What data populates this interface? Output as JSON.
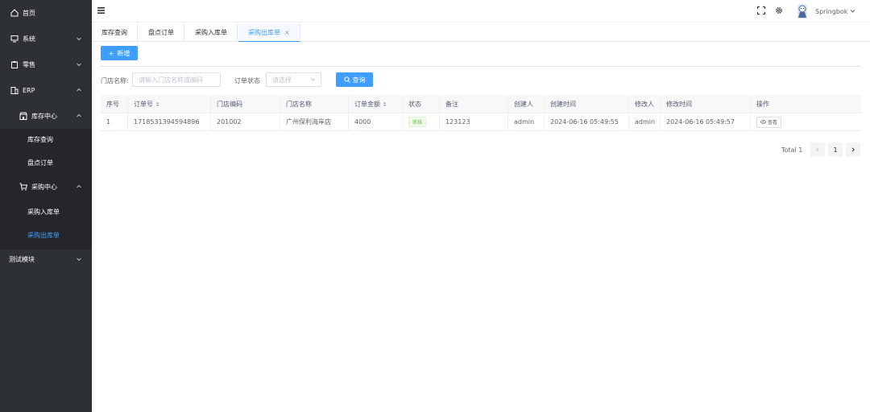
{
  "sidebar": {
    "home": "首页",
    "system": "系统",
    "retail": "零售",
    "erp": "ERP",
    "inventory_center": "库存中心",
    "inventory_query": "库存查询",
    "stocktake_order": "盘点订单",
    "purchase_center": "采购中心",
    "purchase_inbound": "采购入库单",
    "purchase_outbound": "采购出库单",
    "test_module": "测试模块"
  },
  "header": {
    "username": "Springbok"
  },
  "tags": [
    {
      "label": "库存查询"
    },
    {
      "label": "盘点订单"
    },
    {
      "label": "采购入库单"
    },
    {
      "label": "采购出库单",
      "close": "×"
    }
  ],
  "toolbar": {
    "add_label": "新增",
    "add_icon": "+"
  },
  "search": {
    "store_label": "门店名称:",
    "store_placeholder": "请输入门店名称或编码",
    "status_label": "订单状态",
    "status_placeholder": "请选择",
    "query_label": "查询"
  },
  "table": {
    "headers": [
      "序号",
      "订单号",
      "门店编码",
      "门店名称",
      "订单金额",
      "状态",
      "备注",
      "创建人",
      "创建时间",
      "修改人",
      "修改时间",
      "操作"
    ],
    "rows": [
      {
        "index": "1",
        "order_no": "1718531394594896",
        "store_code": "201002",
        "store_name": "广州保利海岸店",
        "amount": "4000",
        "status": "审核",
        "remark": "123123",
        "creator": "admin",
        "created_at": "2024-06-16 05:49:55",
        "modifier": "admin",
        "modified_at": "2024-06-16 05:49:57",
        "action": "查看"
      }
    ]
  },
  "pagination": {
    "total": "Total 1",
    "current": "1"
  },
  "colors": {
    "primary": "#409eff",
    "sidebar": "#2d3035",
    "success": "#67c23a"
  }
}
